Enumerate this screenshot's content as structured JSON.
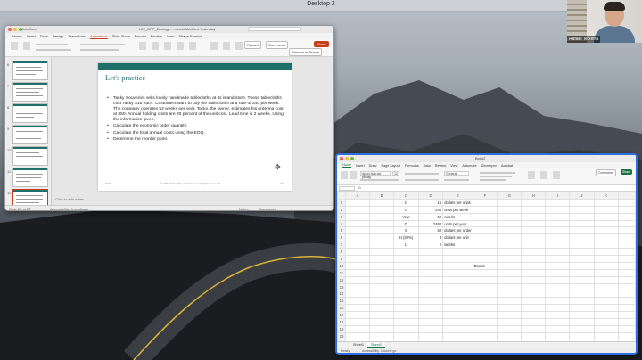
{
  "desktop": {
    "label": "Desktop 2"
  },
  "webcam": {
    "name": "Rafael Teixeira"
  },
  "powerpoint": {
    "autosave": "AutoSave",
    "doc_title": "L22_OPP_Ecology... — Last Modified Yesterday",
    "tabs": [
      "Home",
      "Insert",
      "Draw",
      "Design",
      "Transitions",
      "Animations",
      "Slide Show",
      "Record",
      "Review",
      "View",
      "Shape Format"
    ],
    "active_tab": "Animations",
    "record_label": "Record",
    "comments_label": "Comments",
    "present_label": "Present in Teams",
    "share_label": "Share",
    "slide": {
      "title": "Let's practice",
      "bullets": [
        "Tacky Souvenirs sells lovely handmade tablecloths at its island store. These tablecloths cost Tacky $15 each. Customers want to buy the tablecloths at a rate of 240 per week. The company operates 52 weeks per year. Tacky, the owner, estimates his ordering cost at $50. Annual holding costs are 20 percent of the unit cost. Lead time is 2 weeks. Using the information given,",
        "Calculate the economic order quantity.",
        "Calculate the total annual costs using the EOQ.",
        "Determine the reorder point."
      ],
      "footer_left": "XYZ",
      "footer_center": "© 2022 John Wiley & Sons, Inc. All rights reserved.",
      "footer_right": "22"
    },
    "thumb_numbers": [
      "6",
      "7",
      "8",
      "9",
      "10",
      "11",
      "12"
    ],
    "notes_hint": "Click to add notes",
    "status_left": "Slide 22 of 22",
    "status_access": "Accessibility: Investigate",
    "status_notes": "Notes",
    "status_comments": "Comments"
  },
  "excel": {
    "doc_title": "Book2",
    "tabs": [
      "Home",
      "Insert",
      "Draw",
      "Page Layout",
      "Formulas",
      "Data",
      "Review",
      "View",
      "Automate",
      "Developer",
      "Acrobat"
    ],
    "active_tab": "Home",
    "font_name": "Aptos Narrow (Body)",
    "font_size": "12",
    "number_format": "General",
    "comments_label": "Comments",
    "share_label": "Share",
    "columns": [
      "A",
      "B",
      "C",
      "D",
      "E",
      "F",
      "G",
      "H",
      "I",
      "J",
      "K"
    ],
    "rows": [
      {
        "n": "1",
        "c": "C",
        "d": "15",
        "e": "dollars per units"
      },
      {
        "n": "2",
        "c": "d",
        "d": "240",
        "e": "units per week"
      },
      {
        "n": "3",
        "c": "Year",
        "d": "52",
        "e": "weeks"
      },
      {
        "n": "4",
        "c": "D",
        "d": "12480",
        "e": "units per year"
      },
      {
        "n": "5",
        "c": "S",
        "d": "50",
        "e": "dollars per order"
      },
      {
        "n": "6",
        "c": "H (20%)",
        "d": "3",
        "e": "dollars per unit"
      },
      {
        "n": "7",
        "c": "L",
        "d": "2",
        "e": "weeks"
      },
      {
        "n": "8",
        "c": "",
        "d": "",
        "e": ""
      },
      {
        "n": "9",
        "c": "",
        "d": "",
        "e": ""
      },
      {
        "n": "10",
        "c": "",
        "d": "",
        "e": "",
        "f": "Book2"
      },
      {
        "n": "11"
      },
      {
        "n": "12"
      },
      {
        "n": "13"
      },
      {
        "n": "14"
      },
      {
        "n": "15"
      },
      {
        "n": "16"
      },
      {
        "n": "17"
      },
      {
        "n": "18"
      },
      {
        "n": "19"
      },
      {
        "n": "20"
      },
      {
        "n": "21"
      },
      {
        "n": "22"
      }
    ],
    "sheets": [
      "Sheet1",
      "Sheet2"
    ],
    "active_sheet": "Sheet2",
    "status_ready": "Ready",
    "status_access": "Accessibility: Good to go"
  },
  "colors": {
    "ppt_accent": "#c43e1c",
    "slide_band": "#1f6f6b",
    "excel_accent": "#1e7145",
    "window_focus": "#2d6cdf"
  }
}
